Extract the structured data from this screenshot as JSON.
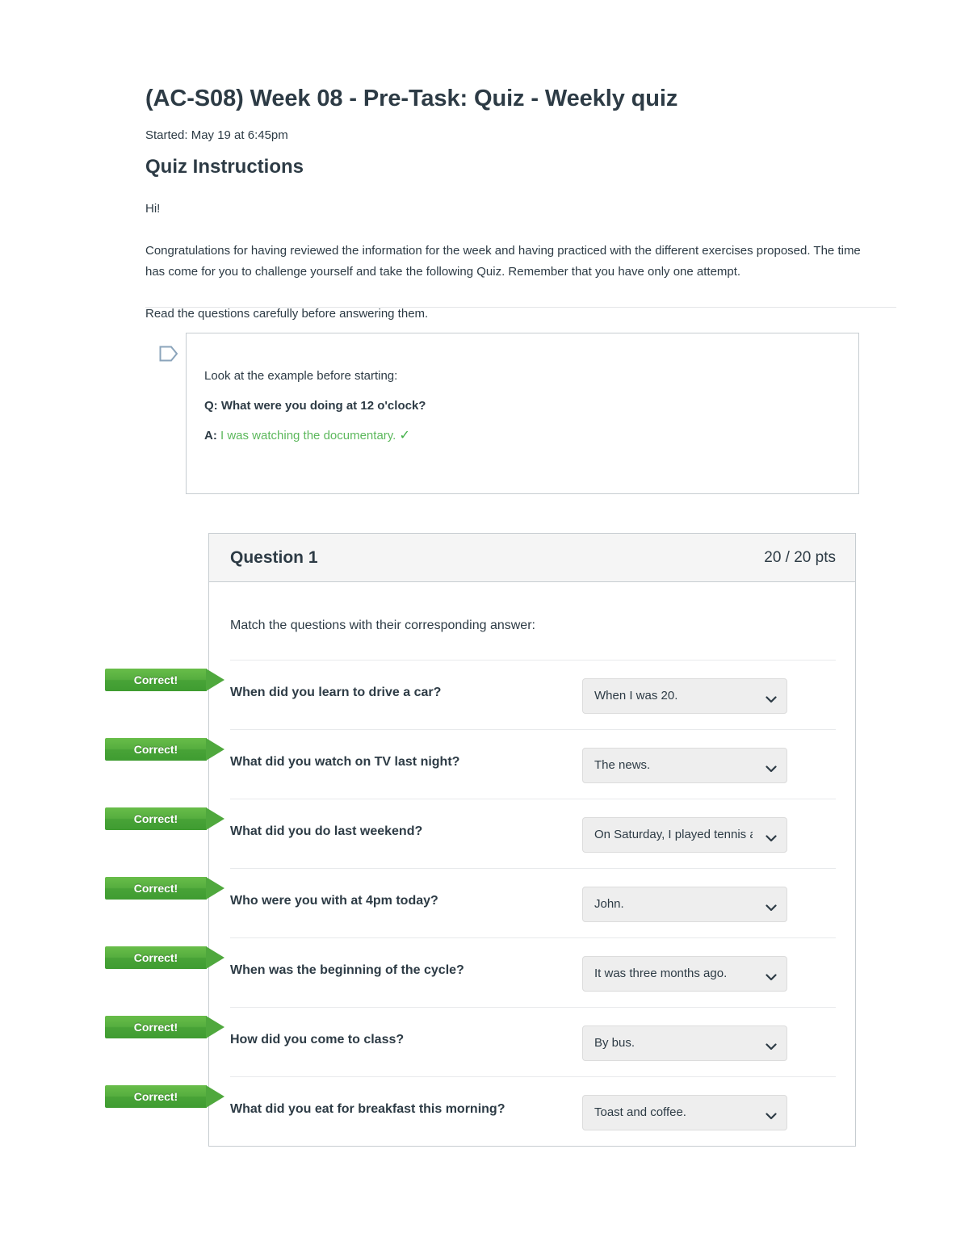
{
  "quiz": {
    "title": "(AC-S08) Week 08 - Pre-Task: Quiz - Weekly quiz",
    "started": "Started: May 19 at 6:45pm",
    "instructions_heading": "Quiz Instructions",
    "greeting": "Hi!",
    "paragraph_1": "Congratulations for having reviewed the information for the week and having practiced with the different exercises proposed. The time has come for you to challenge yourself and take the following Quiz. Remember that you have only one attempt.",
    "paragraph_2": "Read the questions carefully before answering them."
  },
  "example": {
    "intro": "Look at the example before starting:",
    "question_label": "Q:",
    "question_text": " What were you doing at 12 o'clock?",
    "answer_label": "A:",
    "answer_text": "I was watching the documentary.",
    "check_mark": "✓",
    "answer_color": "#5cb85c"
  },
  "question": {
    "name": "Question 1",
    "points": "20 / 20 pts",
    "prompt": "Match the questions with their corresponding answer:",
    "correct_badge_label": "Correct!",
    "badge_color": "#4fa83d",
    "rows": [
      {
        "badge": "Correct!",
        "question": "When did you learn to drive a car?",
        "answer": "When I was 20."
      },
      {
        "badge": "Correct!",
        "question": "What did you watch on TV last night?",
        "answer": "The news."
      },
      {
        "badge": "Correct!",
        "question": "What did you do last weekend?",
        "answer": "On Saturday, I played tennis a"
      },
      {
        "badge": "Correct!",
        "question": "Who were you with at 4pm today?",
        "answer": "John."
      },
      {
        "badge": "Correct!",
        "question": "When was the beginning of the cycle?",
        "answer": "It was three months ago."
      },
      {
        "badge": "Correct!",
        "question": "How did you come to class?",
        "answer": "By bus."
      },
      {
        "badge": "Correct!",
        "question": "What did you eat for breakfast this morning?",
        "answer": "Toast and coffee."
      }
    ]
  }
}
